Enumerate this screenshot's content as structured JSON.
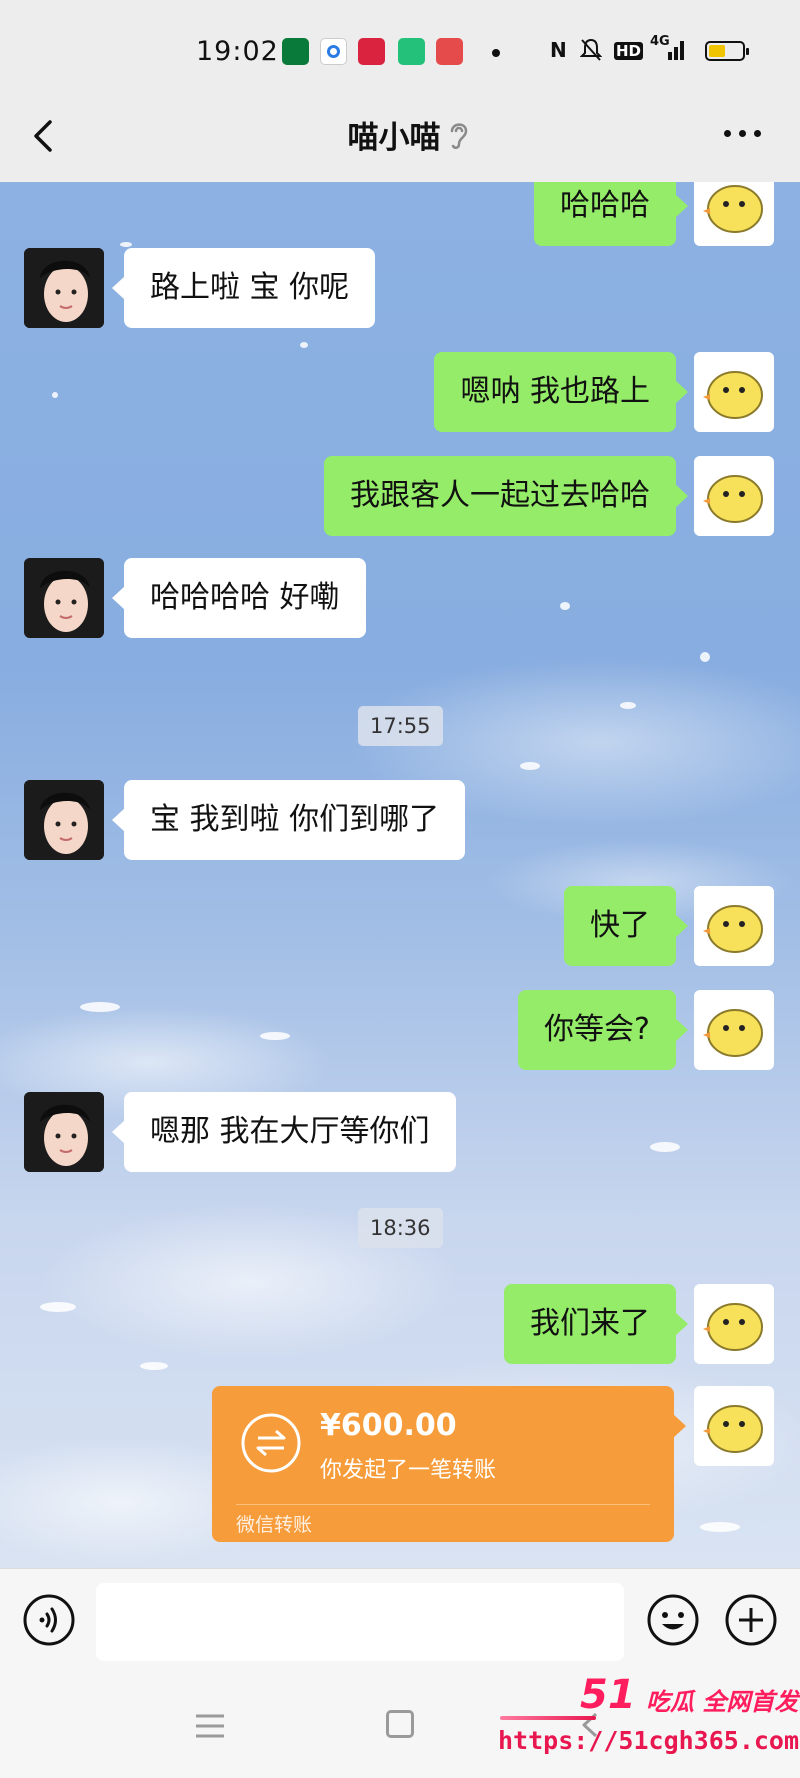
{
  "status_bar": {
    "time": "19:02",
    "network": "4G",
    "hd_label": "HD",
    "nfc_label": "N"
  },
  "header": {
    "title": "喵小喵"
  },
  "messages": [
    {
      "side": "me",
      "text": "哈哈哈"
    },
    {
      "side": "other",
      "text": "路上啦 宝 你呢"
    },
    {
      "side": "me",
      "text": "嗯呐 我也路上"
    },
    {
      "side": "me",
      "text": "我跟客人一起过去哈哈"
    },
    {
      "side": "other",
      "text": "哈哈哈哈 好嘞"
    },
    {
      "side": "time",
      "text": "17:55"
    },
    {
      "side": "other",
      "text": "宝 我到啦 你们到哪了"
    },
    {
      "side": "me",
      "text": "快了"
    },
    {
      "side": "me",
      "text": "你等会?"
    },
    {
      "side": "other",
      "text": "嗯那 我在大厅等你们"
    },
    {
      "side": "time",
      "text": "18:36"
    },
    {
      "side": "me",
      "text": "我们来了"
    }
  ],
  "transfer": {
    "amount": "¥600.00",
    "description": "你发起了一笔转账",
    "source": "微信转账",
    "color": "#f79c3a"
  },
  "input": {
    "value": "",
    "placeholder": ""
  },
  "icons": {
    "back": "back-chevron-icon",
    "ear": "ear-icon",
    "more": "more-dots-icon",
    "voice": "voice-icon",
    "emoji": "emoji-icon",
    "plus": "plus-icon"
  },
  "colors": {
    "my_bubble": "#95ec69",
    "their_bubble": "#ffffff",
    "watermark": "#ff1d5e"
  },
  "watermark": {
    "logo_number": "51",
    "logo_text": "吃瓜 全网首发",
    "url": "https://51cgh365.com"
  }
}
